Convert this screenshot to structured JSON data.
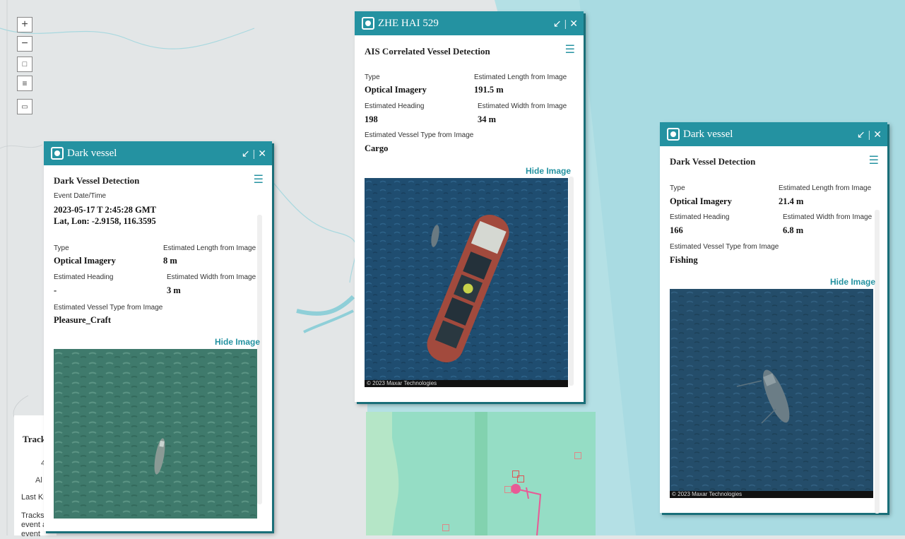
{
  "map": {
    "controls": [
      "+",
      "−",
      "□",
      "≡",
      "▭"
    ],
    "tracks_panel": {
      "title": "Track",
      "line1": "4",
      "line2": "Al",
      "line3": "Last Kr",
      "line4": "Tracks\nevent a\nevent"
    },
    "colors": {
      "land": "#e3e6e7",
      "sea": "#b4e0e5",
      "aoi": "#8fdcc0",
      "track": "#e85a96"
    }
  },
  "popups": [
    {
      "title": "Dark vessel",
      "section": "Dark Vessel Detection",
      "event_label": "Event Date/Time",
      "event_value": "2023-05-17 T 2:45:28 GMT",
      "latlon": "Lat, Lon: -2.9158, 116.3595",
      "type_label": "Type",
      "type_value": "Optical Imagery",
      "length_label": "Estimated Length from Image",
      "length_value": "8 m",
      "heading_label": "Estimated Heading",
      "heading_value": "-",
      "width_label": "Estimated Width from Image",
      "width_value": "3 m",
      "vtype_label": "Estimated Vessel Type from Image",
      "vtype_value": "Pleasure_Craft",
      "hide_image": "Hide Image"
    },
    {
      "title": "ZHE HAI 529",
      "section": "AIS Correlated Vessel Detection",
      "type_label": "Type",
      "type_value": "Optical Imagery",
      "length_label": "Estimated Length from Image",
      "length_value": "191.5 m",
      "heading_label": "Estimated Heading",
      "heading_value": "198",
      "width_label": "Estimated Width from Image",
      "width_value": "34 m",
      "vtype_label": "Estimated Vessel Type from Image",
      "vtype_value": "Cargo",
      "hide_image": "Hide Image",
      "credit": "© 2023 Maxar Technologies"
    },
    {
      "title": "Dark vessel",
      "section": "Dark Vessel Detection",
      "type_label": "Type",
      "type_value": "Optical Imagery",
      "length_label": "Estimated Length from Image",
      "length_value": "21.4 m",
      "heading_label": "Estimated Heading",
      "heading_value": "166",
      "width_label": "Estimated Width from Image",
      "width_value": "6.8 m",
      "vtype_label": "Estimated Vessel Type from Image",
      "vtype_value": "Fishing",
      "hide_image": "Hide Image",
      "credit": "© 2023 Maxar Technologies"
    }
  ],
  "header_controls": {
    "minimize": "↙",
    "close": "✕"
  },
  "icons": {
    "popup_icon": "camera-target-icon",
    "menu": "hamburger-menu-icon"
  }
}
